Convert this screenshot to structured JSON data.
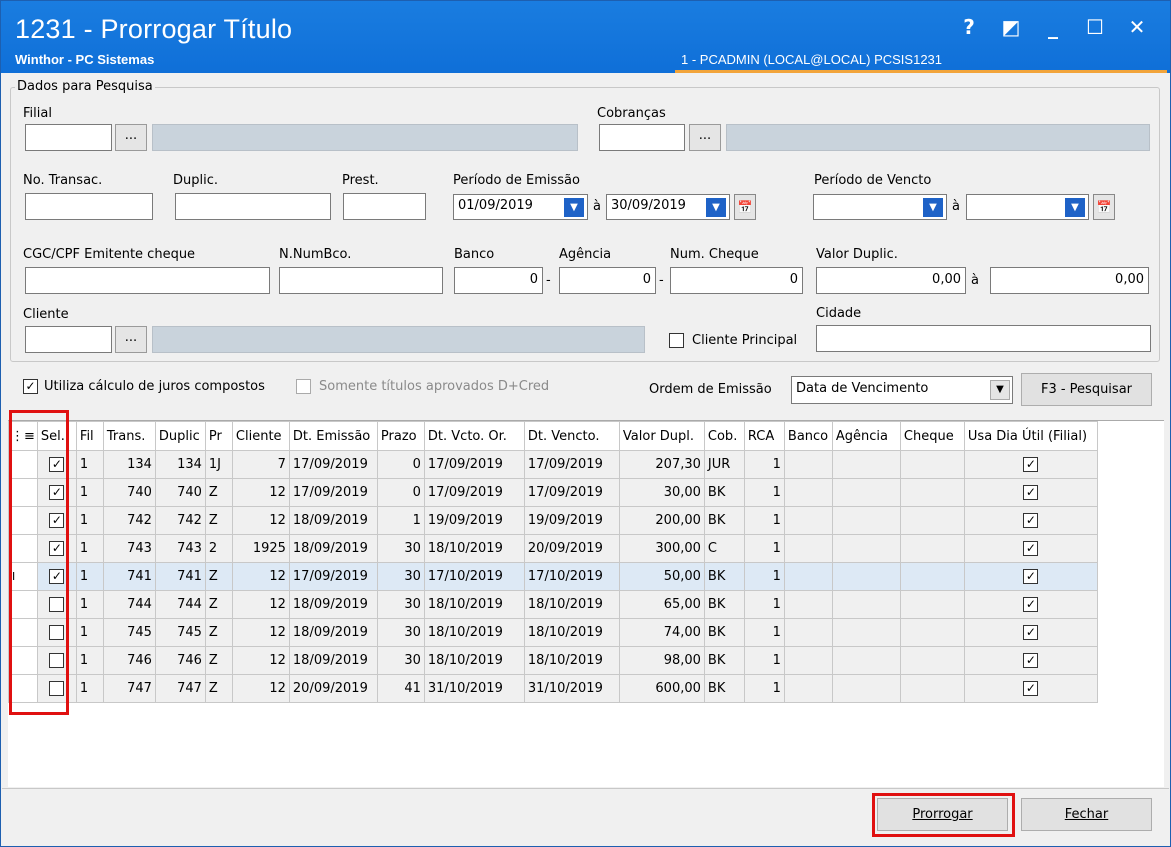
{
  "window": {
    "title": "1231 - Prorrogar Título",
    "subtitle": "Winthor - PC Sistemas",
    "user_info": "1 - PCADMIN (LOCAL@LOCAL)   PCSIS1231",
    "buttons": {
      "help": "?",
      "restore": "◩",
      "minimize": "_",
      "maximize": "☐",
      "close": "✕"
    }
  },
  "search": {
    "legend": "Dados para Pesquisa",
    "filial_label": "Filial",
    "filial_value": "",
    "cobrancas_label": "Cobranças",
    "cobrancas_value": "",
    "dots": "...",
    "transac_label": "No. Transac.",
    "duplic_label": "Duplic.",
    "prest_label": "Prest.",
    "emissao_label": "Período de Emissão",
    "emissao_from": "01/09/2019",
    "emissao_to": "30/09/2019",
    "a_label": "à",
    "vencto_label": "Período de Vencto",
    "vencto_from": "",
    "vencto_to": "",
    "cgc_label": "CGC/CPF Emitente cheque",
    "numbco_label": "N.NumBco.",
    "banco_label": "Banco",
    "banco_value": "0",
    "agencia_label": "Agência",
    "agencia_value": "0",
    "cheque_label": "Num. Cheque",
    "cheque_value": "0",
    "valor_label": "Valor Duplic.",
    "valor_from": "0,00",
    "valor_to": "0,00",
    "cliente_label": "Cliente",
    "cliente_principal_label": "Cliente Principal",
    "cidade_label": "Cidade",
    "dash": "-"
  },
  "options": {
    "juros_label": "Utiliza cálculo de juros compostos",
    "juros_checked": true,
    "dcred_label": "Somente títulos aprovados D+Cred",
    "dcred_checked": false,
    "ordem_label": "Ordem de Emissão",
    "ordem_value": "Data de Vencimento",
    "pesquisar_label": "F3 - Pesquisar"
  },
  "grid": {
    "columns": [
      "Sel.",
      "Fil",
      "Trans.",
      "Duplic",
      "Pr",
      "Cliente",
      "Dt. Emissão",
      "Prazo",
      "Dt. Vcto. Or.",
      "Dt. Vencto.",
      "Valor Dupl.",
      "Cob.",
      "RCA",
      "Banco",
      "Agência",
      "Cheque",
      "Usa Dia Útil (Filial)"
    ],
    "rows": [
      {
        "sel": true,
        "fil": "1",
        "trans": "134",
        "duplic": "134",
        "pr": "1J",
        "cliente": "7",
        "emissao": "17/09/2019",
        "prazo": "0",
        "vcto_or": "17/09/2019",
        "vencto": "17/09/2019",
        "valor": "207,30",
        "cob": "JUR",
        "rca": "1",
        "banco": "",
        "agencia": "",
        "cheque": "",
        "dia_util": true
      },
      {
        "sel": true,
        "fil": "1",
        "trans": "740",
        "duplic": "740",
        "pr": "Z",
        "cliente": "12",
        "emissao": "17/09/2019",
        "prazo": "0",
        "vcto_or": "17/09/2019",
        "vencto": "17/09/2019",
        "valor": "30,00",
        "cob": "BK",
        "rca": "1",
        "banco": "",
        "agencia": "",
        "cheque": "",
        "dia_util": true
      },
      {
        "sel": true,
        "fil": "1",
        "trans": "742",
        "duplic": "742",
        "pr": "Z",
        "cliente": "12",
        "emissao": "18/09/2019",
        "prazo": "1",
        "vcto_or": "19/09/2019",
        "vencto": "19/09/2019",
        "valor": "200,00",
        "cob": "BK",
        "rca": "1",
        "banco": "",
        "agencia": "",
        "cheque": "",
        "dia_util": true
      },
      {
        "sel": true,
        "fil": "1",
        "trans": "743",
        "duplic": "743",
        "pr": "2",
        "cliente": "1925",
        "emissao": "18/09/2019",
        "prazo": "30",
        "vcto_or": "18/10/2019",
        "vencto": "20/09/2019",
        "valor": "300,00",
        "cob": "C",
        "rca": "1",
        "banco": "",
        "agencia": "",
        "cheque": "",
        "dia_util": true
      },
      {
        "sel": true,
        "fil": "1",
        "trans": "741",
        "duplic": "741",
        "pr": "Z",
        "cliente": "12",
        "emissao": "17/09/2019",
        "prazo": "30",
        "vcto_or": "17/10/2019",
        "vencto": "17/10/2019",
        "valor": "50,00",
        "cob": "BK",
        "rca": "1",
        "banco": "",
        "agencia": "",
        "cheque": "",
        "dia_util": true,
        "current": true
      },
      {
        "sel": false,
        "fil": "1",
        "trans": "744",
        "duplic": "744",
        "pr": "Z",
        "cliente": "12",
        "emissao": "18/09/2019",
        "prazo": "30",
        "vcto_or": "18/10/2019",
        "vencto": "18/10/2019",
        "valor": "65,00",
        "cob": "BK",
        "rca": "1",
        "banco": "",
        "agencia": "",
        "cheque": "",
        "dia_util": true
      },
      {
        "sel": false,
        "fil": "1",
        "trans": "745",
        "duplic": "745",
        "pr": "Z",
        "cliente": "12",
        "emissao": "18/09/2019",
        "prazo": "30",
        "vcto_or": "18/10/2019",
        "vencto": "18/10/2019",
        "valor": "74,00",
        "cob": "BK",
        "rca": "1",
        "banco": "",
        "agencia": "",
        "cheque": "",
        "dia_util": true
      },
      {
        "sel": false,
        "fil": "1",
        "trans": "746",
        "duplic": "746",
        "pr": "Z",
        "cliente": "12",
        "emissao": "18/09/2019",
        "prazo": "30",
        "vcto_or": "18/10/2019",
        "vencto": "18/10/2019",
        "valor": "98,00",
        "cob": "BK",
        "rca": "1",
        "banco": "",
        "agencia": "",
        "cheque": "",
        "dia_util": true
      },
      {
        "sel": false,
        "fil": "1",
        "trans": "747",
        "duplic": "747",
        "pr": "Z",
        "cliente": "12",
        "emissao": "20/09/2019",
        "prazo": "41",
        "vcto_or": "31/10/2019",
        "vencto": "31/10/2019",
        "valor": "600,00",
        "cob": "BK",
        "rca": "1",
        "banco": "",
        "agencia": "",
        "cheque": "",
        "dia_util": true
      }
    ]
  },
  "footer": {
    "prorrogar_label": "Prorrogar",
    "fechar_label": "Fechar"
  },
  "icons": {
    "check": "✓",
    "dropdown": "▼",
    "calendar": "📅"
  },
  "colors": {
    "title_bar": "#1a7de0",
    "highlight": "#e01010",
    "accent_line": "#f2a43a"
  }
}
